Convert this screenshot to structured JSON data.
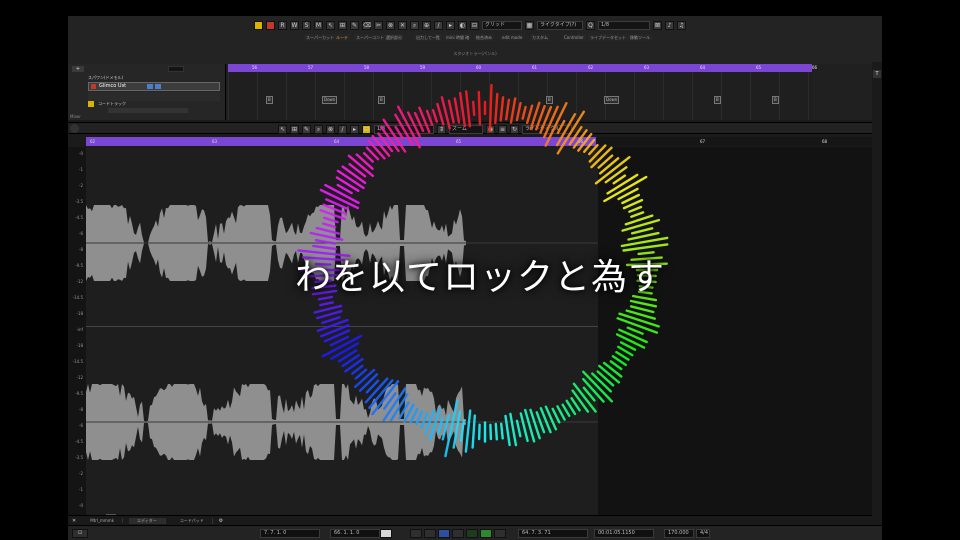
{
  "caption": "わを以てロックと為す",
  "toolbar": {
    "snap_label": "グリッド",
    "snap_type": "ライクタイプ(?)",
    "quantize": "1/8",
    "modes": [
      "スーパーカット",
      "ルーテ",
      "スーパーコント",
      "選択部分",
      "出力して一覧",
      "mini 時間 確",
      "結合済み",
      "edit mode",
      "カスタム",
      "Controller",
      "ライブデータセット",
      "移動ツール"
    ],
    "guide": "スタジオトラー(パンル)"
  },
  "tracks": {
    "header1": "スパワン(ドメモル)",
    "track1_name": "Glimco Ust",
    "track2_name": "コードトラック",
    "labels": [
      "Mixer"
    ]
  },
  "ruler_top": [
    "56",
    "57",
    "58",
    "59",
    "60",
    "61",
    "62",
    "63",
    "64",
    "65",
    "66"
  ],
  "clips": [
    "B",
    "Down",
    "B",
    "B",
    "Down",
    "B",
    "B"
  ],
  "editor": {
    "toolbar_label1": "1/8",
    "toolbar_label2": "ズーム",
    "toolbar_label3": "ライトサイクル",
    "ruler": [
      "62",
      "63",
      "64",
      "65",
      "66",
      "67",
      "68"
    ],
    "marker": "カウントポイント"
  },
  "db_scale": [
    "-0",
    "-1",
    "-2",
    "-3.5",
    "-4.5",
    "-6",
    "-8",
    "-9.5",
    "-12",
    "-14.5",
    "-18",
    "-inf",
    "-18",
    "-14.5",
    "-12",
    "-9.5",
    "-8",
    "-6",
    "-4.5",
    "-3.5",
    "-2",
    "-1",
    "-0"
  ],
  "tabs": [
    "Mtrl_mmmk",
    "エディター",
    "コードパッド"
  ],
  "transport": {
    "pos1": "7. 7. 1. 0",
    "pos2": "66. 1. 1. 0",
    "pos3": "64. 7. 3. 71",
    "time": "00:01:05.1150",
    "tempo": "170.000",
    "sig": "4/4"
  },
  "colors": {
    "ruler": "#7b46d4",
    "bg": "#1b1b1b",
    "wave": "#8f8f8f"
  }
}
